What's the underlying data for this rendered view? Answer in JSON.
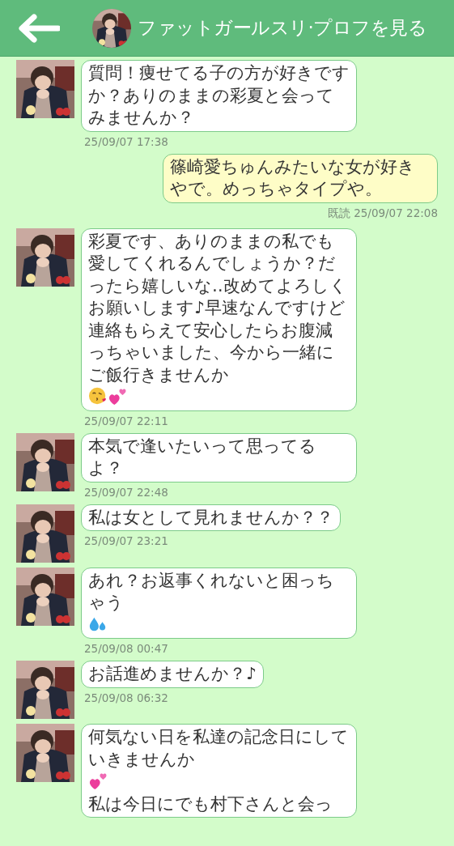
{
  "header": {
    "title": "ファットガールスリ·プロフを見る"
  },
  "messages": [
    {
      "kind": "received",
      "parts": [
        {
          "kind": "text",
          "text": "質問！痩せてる子の方が好きですか？ありのままの彩夏と会ってみませんか？"
        }
      ],
      "time": "25/09/07 17:38"
    },
    {
      "kind": "sent",
      "parts": [
        {
          "kind": "text",
          "text": "篠崎愛ちゅんみたいな女が好きやで。めっちゃタイプや。"
        }
      ],
      "time": "既読 25/09/07 22:08"
    },
    {
      "kind": "received",
      "parts": [
        {
          "kind": "text",
          "text": "彩夏です、ありのままの私でも愛してくれるんでしょうか？だったら嬉しいな‥改めてよろしくお願いします♪早速なんですけど連絡もらえて安心したらお腹減っちゃいました、今から一緒にご飯行きませんか"
        },
        {
          "kind": "kiss"
        },
        {
          "kind": "hearts"
        }
      ],
      "time": "25/09/07 22:11"
    },
    {
      "kind": "received",
      "parts": [
        {
          "kind": "text",
          "text": "本気で逢いたいって思ってるよ？"
        }
      ],
      "time": "25/09/07 22:48"
    },
    {
      "kind": "received",
      "parts": [
        {
          "kind": "text",
          "text": "私は女として見れませんか？？"
        }
      ],
      "time": "25/09/07 23:21"
    },
    {
      "kind": "received",
      "parts": [
        {
          "kind": "text",
          "text": "あれ？お返事くれないと困っちゃう"
        },
        {
          "kind": "drops"
        }
      ],
      "time": "25/09/08 00:47"
    },
    {
      "kind": "received",
      "parts": [
        {
          "kind": "text",
          "text": "お話進めませんか？♪"
        }
      ],
      "time": "25/09/08 06:32"
    },
    {
      "kind": "received",
      "parts": [
        {
          "kind": "text",
          "text": "何気ない日を私達の記念日にしていきませんか"
        },
        {
          "kind": "hearts"
        },
        {
          "kind": "break"
        },
        {
          "kind": "text",
          "text": "私は今日にでも村下さんと会っ"
        }
      ]
    }
  ]
}
